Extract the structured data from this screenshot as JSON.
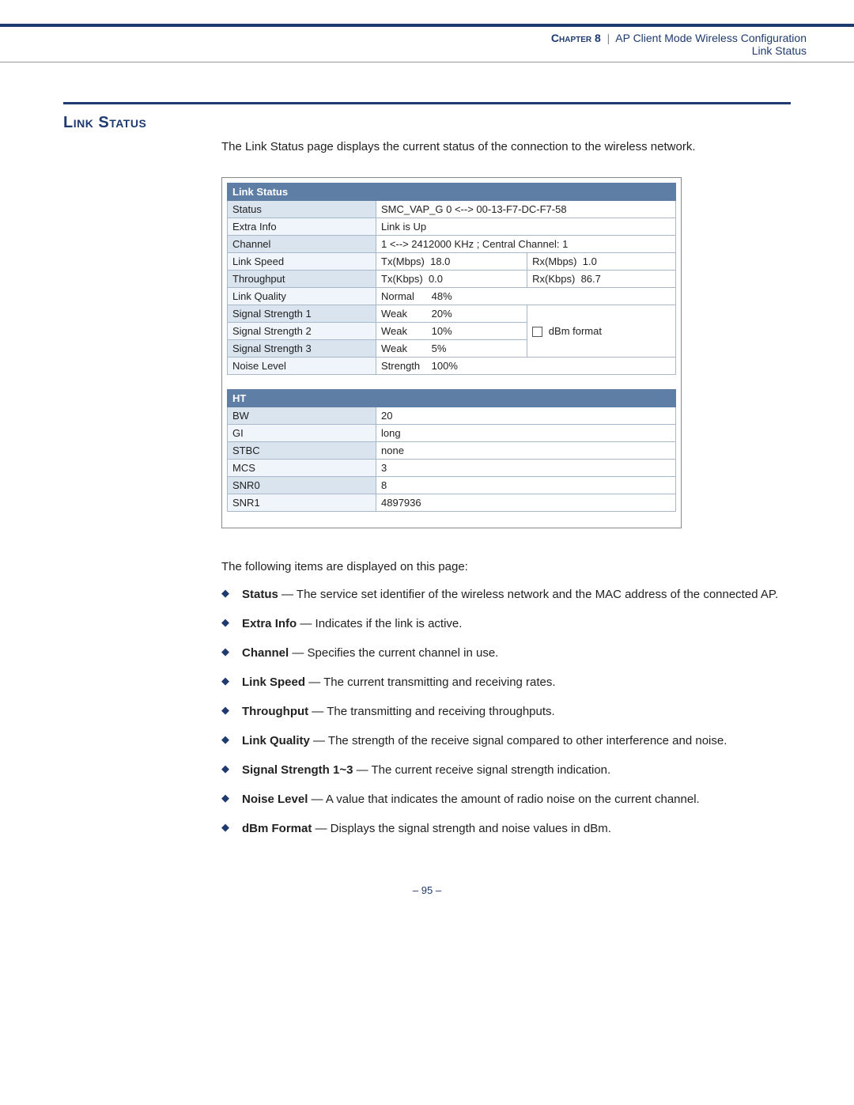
{
  "header": {
    "chapter": "Chapter 8",
    "separator": "|",
    "chapter_title": "AP Client Mode Wireless Configuration",
    "subtitle": "Link Status"
  },
  "section": {
    "title": "Link Status",
    "intro": "The Link Status page displays the current status of the connection to the wireless network."
  },
  "link_status_table": {
    "header": "Link Status",
    "rows": {
      "status_label": "Status",
      "status_value": "SMC_VAP_G 0 <--> 00-13-F7-DC-F7-58",
      "extra_info_label": "Extra Info",
      "extra_info_value": "Link is Up",
      "channel_label": "Channel",
      "channel_value": "1 <--> 2412000 KHz ; Central Channel: 1",
      "link_speed_label": "Link Speed",
      "link_speed_tx": "Tx(Mbps)  18.0",
      "link_speed_rx": "Rx(Mbps)  1.0",
      "throughput_label": "Throughput",
      "throughput_tx": "Tx(Kbps)  0.0",
      "throughput_rx": "Rx(Kbps)  86.7",
      "link_quality_label": "Link Quality",
      "link_quality_q": "Normal",
      "link_quality_v": "48%",
      "ss1_label": "Signal Strength 1",
      "ss1_q": "Weak",
      "ss1_v": "20%",
      "ss2_label": "Signal Strength 2",
      "ss2_q": "Weak",
      "ss2_v": "10%",
      "ss3_label": "Signal Strength 3",
      "ss3_q": "Weak",
      "ss3_v": "5%",
      "noise_label": "Noise Level",
      "noise_q": "Strength",
      "noise_v": "100%",
      "dbm_label": "dBm format"
    }
  },
  "ht_table": {
    "header": "HT",
    "rows": [
      {
        "label": "BW",
        "value": "20"
      },
      {
        "label": "GI",
        "value": "long"
      },
      {
        "label": "STBC",
        "value": "none"
      },
      {
        "label": "MCS",
        "value": "3"
      },
      {
        "label": "SNR0",
        "value": "8"
      },
      {
        "label": "SNR1",
        "value": "4897936"
      }
    ]
  },
  "items_intro": "The following items are displayed on this page:",
  "items": [
    {
      "term": "Status",
      "desc": " — The service set identifier of the wireless network and the MAC address of the connected AP."
    },
    {
      "term": "Extra Info",
      "desc": " — Indicates if the link is active."
    },
    {
      "term": "Channel",
      "desc": " — Specifies the current channel in use."
    },
    {
      "term": "Link Speed",
      "desc": " — The current transmitting and receiving rates."
    },
    {
      "term": "Throughput",
      "desc": " — The transmitting and receiving throughputs."
    },
    {
      "term": "Link Quality",
      "desc": " — The strength of the receive signal compared to other interference and noise."
    },
    {
      "term": "Signal Strength 1~3",
      "desc": " — The current receive signal strength indication."
    },
    {
      "term": "Noise Level",
      "desc": " — A value that indicates the amount of radio noise on the current channel."
    },
    {
      "term": "dBm Format",
      "desc": " — Displays the signal strength and noise values in dBm."
    }
  ],
  "page_number": "–  95  –"
}
